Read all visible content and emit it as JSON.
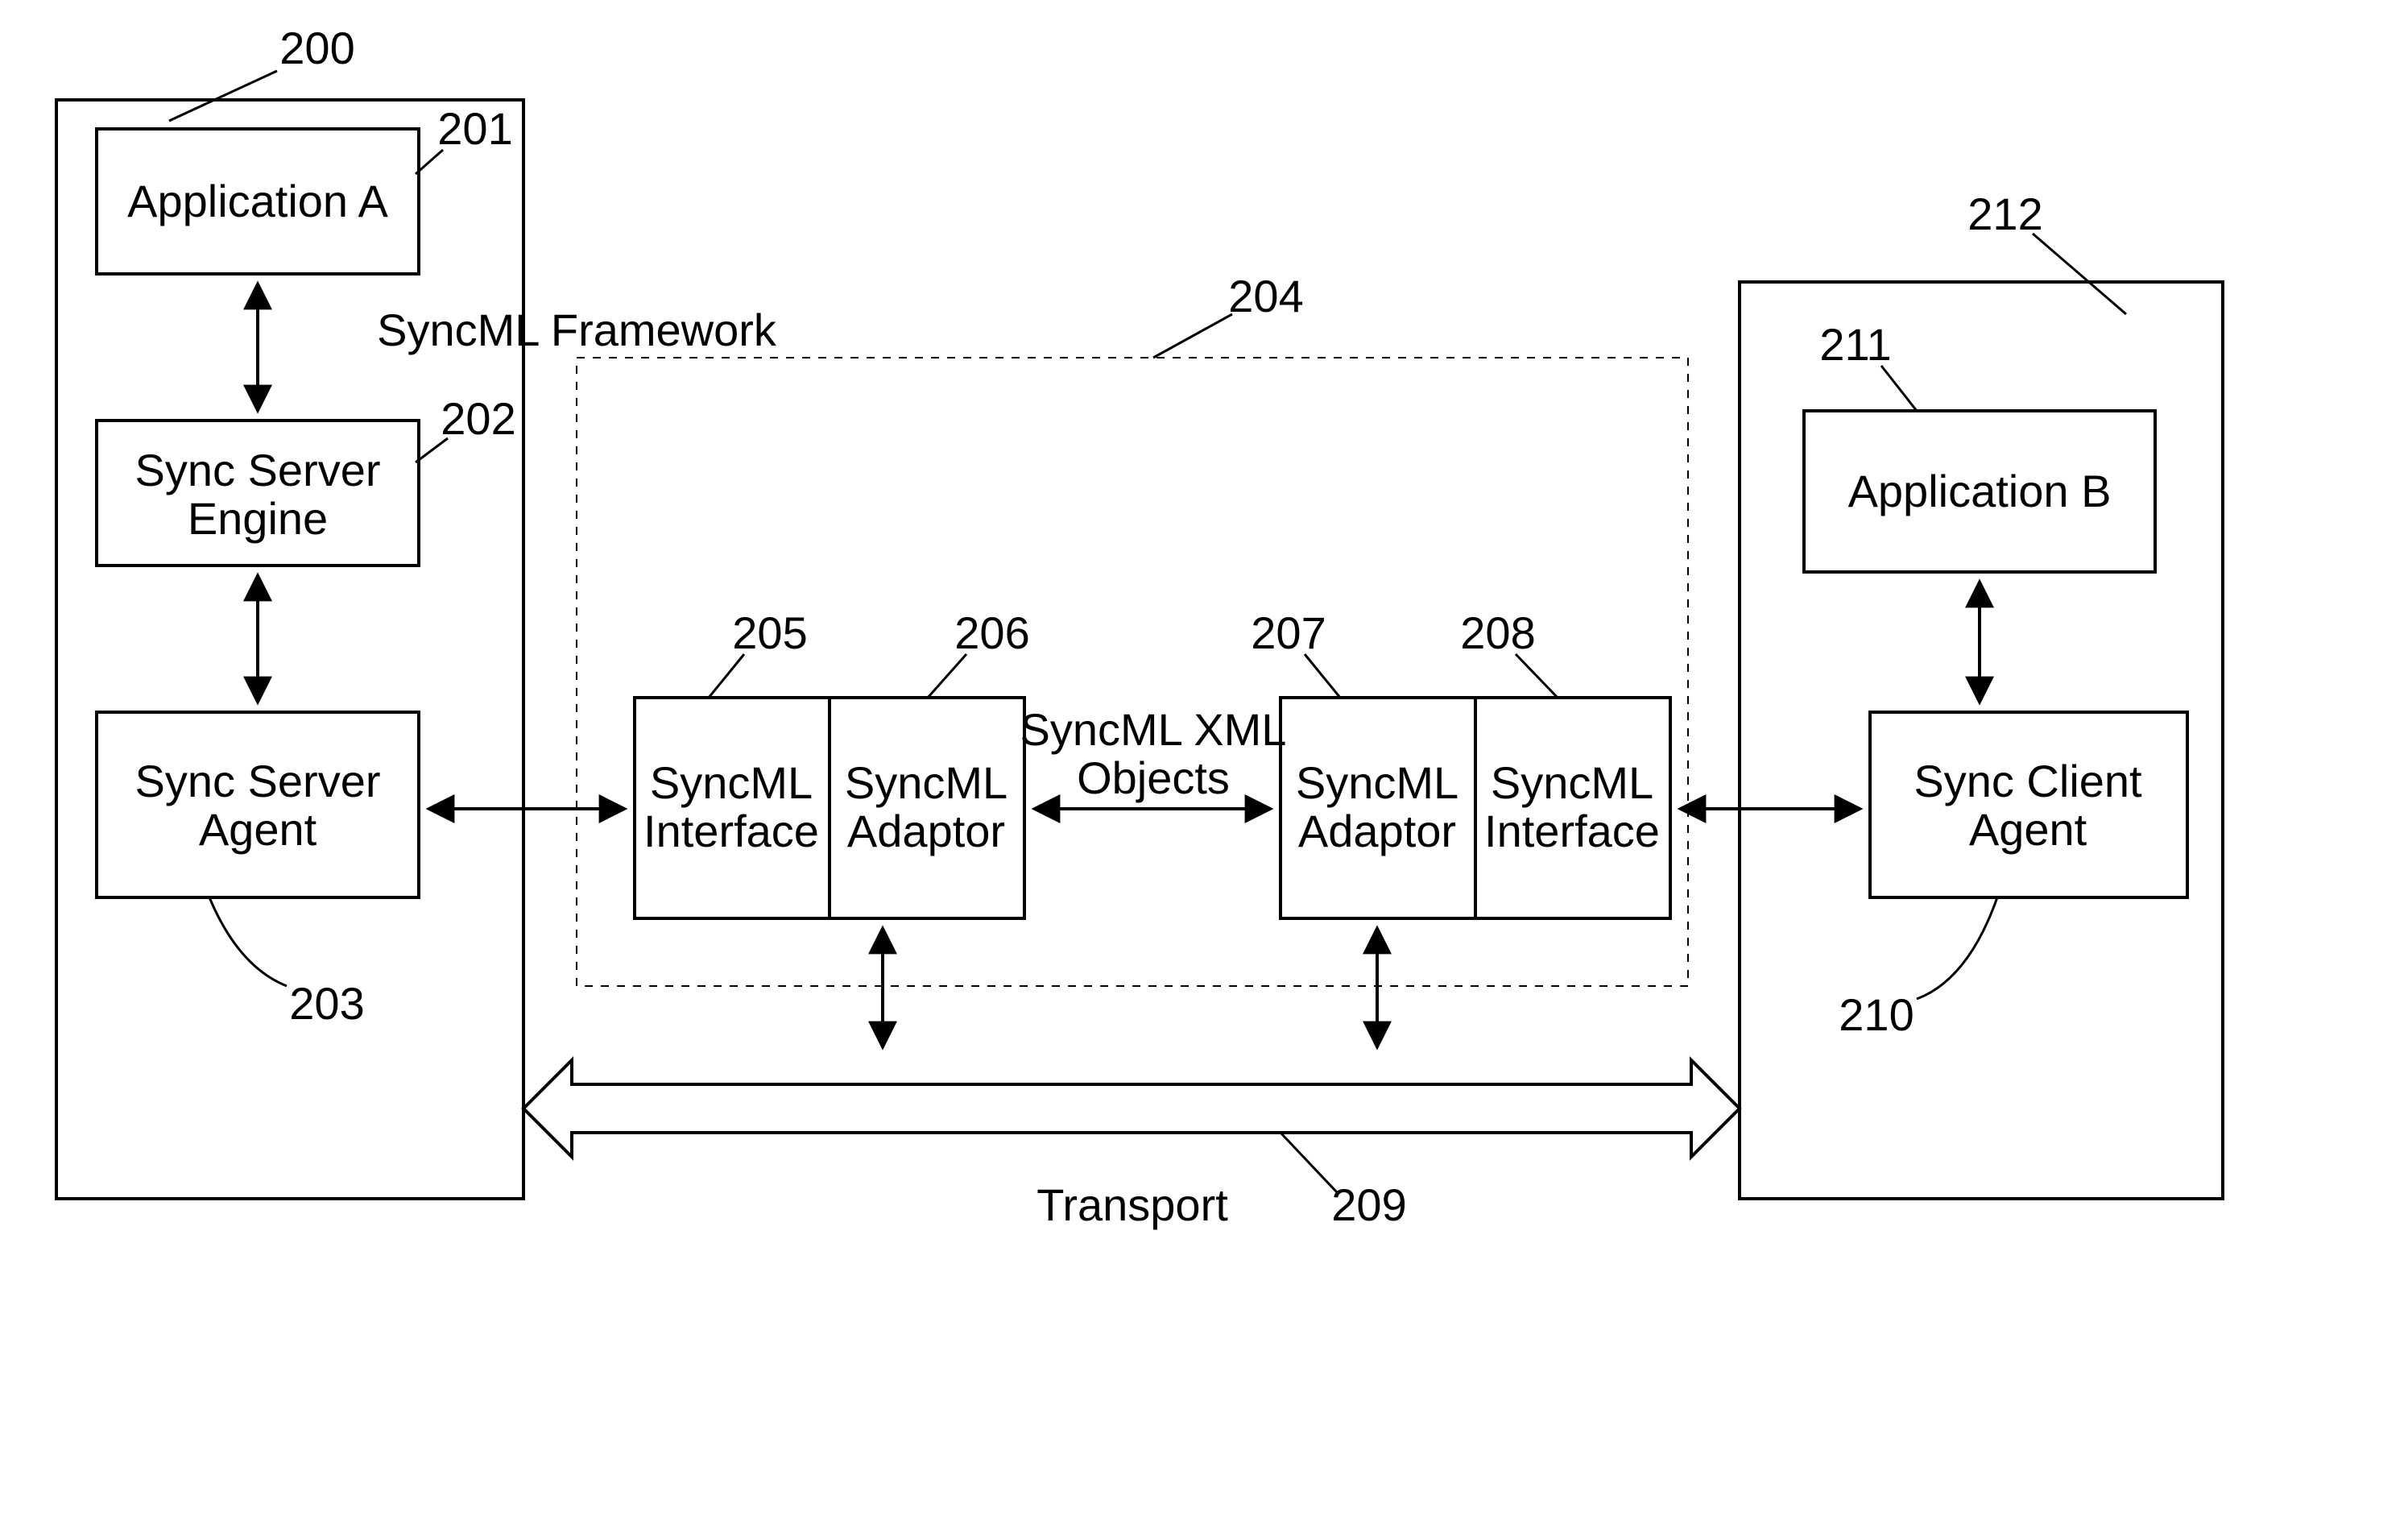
{
  "refs": {
    "r200": "200",
    "r201": "201",
    "r202": "202",
    "r203": "203",
    "r204": "204",
    "r205": "205",
    "r206": "206",
    "r207": "207",
    "r208": "208",
    "r209": "209",
    "r210": "210",
    "r211": "211",
    "r212": "212"
  },
  "labels": {
    "application_a": "Application A",
    "sync_server_engine_l1": "Sync Server",
    "sync_server_engine_l2": "Engine",
    "sync_server_agent_l1": "Sync Server",
    "sync_server_agent_l2": "Agent",
    "framework_title": "SyncML Framework",
    "syncml_interface_l1": "SyncML",
    "syncml_interface_l2": "Interface",
    "syncml_adaptor_l1": "SyncML",
    "syncml_adaptor_l2": "Adaptor",
    "xml_objects_l1": "SyncML XML",
    "xml_objects_l2": "Objects",
    "application_b": "Application B",
    "sync_client_agent_l1": "Sync Client",
    "sync_client_agent_l2": "Agent",
    "transport": "Transport"
  }
}
